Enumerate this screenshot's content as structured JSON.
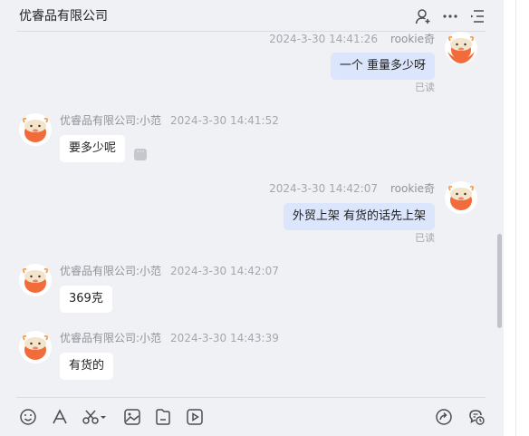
{
  "header": {
    "title": "优睿品有限公司",
    "icons": [
      "user-add-icon",
      "more-icon",
      "menu-icon"
    ]
  },
  "messages": [
    {
      "direction": "out",
      "sender": "rookie奇",
      "time": "2024-3-30 14:41:26",
      "text": "一个 重量多少呀",
      "status": "已读"
    },
    {
      "direction": "in",
      "sender": "优睿品有限公司:小范",
      "time": "2024-3-30 14:41:52",
      "text": "要多少呢",
      "more_button": "···"
    },
    {
      "direction": "out",
      "sender": "rookie奇",
      "time": "2024-3-30 14:42:07",
      "text": "外贸上架 有货的话先上架",
      "status": "已读"
    },
    {
      "direction": "in",
      "sender": "优睿品有限公司:小范",
      "time": "2024-3-30 14:42:07",
      "text": "369克"
    },
    {
      "direction": "in",
      "sender": "优睿品有限公司:小范",
      "time": "2024-3-30 14:43:39",
      "text": "有货的"
    }
  ],
  "toolbar": {
    "left_icons": [
      "emoji-icon",
      "font-icon",
      "scissors-icon",
      "image-icon",
      "file-icon",
      "video-icon"
    ],
    "right_icons": [
      "share-icon",
      "chat-history-icon"
    ]
  },
  "colors": {
    "background": "#f0f1f5",
    "incoming_bubble": "#ffffff",
    "outgoing_bubble": "#dbe6fc",
    "avatar_orange": "#f26b3a"
  }
}
